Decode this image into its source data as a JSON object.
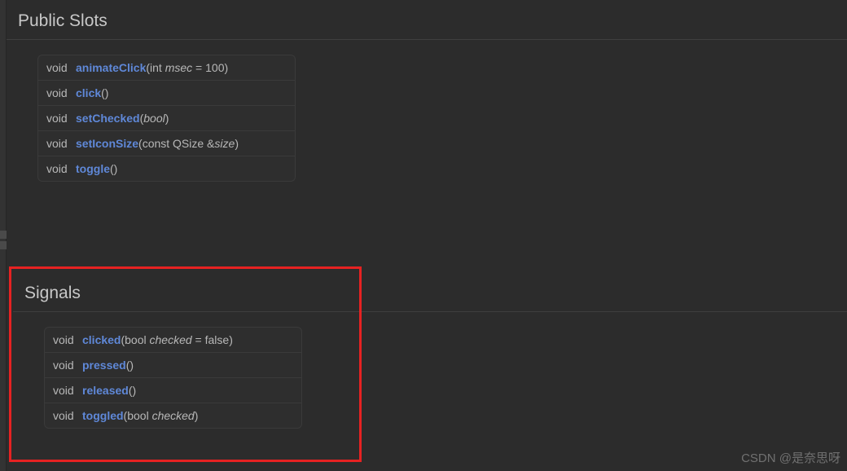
{
  "sections": {
    "slots": {
      "title": "Public Slots",
      "rowsRet": [
        "void",
        "void",
        "void",
        "void",
        "void"
      ],
      "rows": [
        {
          "fn": "animateClick",
          "params_pre": "(int ",
          "params_ital": "msec",
          "params_post": " = 100)"
        },
        {
          "fn": "click",
          "params_pre": "()",
          "params_ital": "",
          "params_post": ""
        },
        {
          "fn": "setChecked",
          "params_pre": "(",
          "params_ital": "bool",
          "params_post": ")"
        },
        {
          "fn": "setIconSize",
          "params_pre": "(const QSize &",
          "params_ital": "size",
          "params_post": ")"
        },
        {
          "fn": "toggle",
          "params_pre": "()",
          "params_ital": "",
          "params_post": ""
        }
      ]
    },
    "signals": {
      "title": "Signals",
      "rowsRet": [
        "void",
        "void",
        "void",
        "void"
      ],
      "rows": [
        {
          "fn": "clicked",
          "params_pre": "(bool ",
          "params_ital": "checked",
          "params_post": " = false)"
        },
        {
          "fn": "pressed",
          "params_pre": "()",
          "params_ital": "",
          "params_post": ""
        },
        {
          "fn": "released",
          "params_pre": "()",
          "params_ital": "",
          "params_post": ""
        },
        {
          "fn": "toggled",
          "params_pre": "(bool ",
          "params_ital": "checked",
          "params_post": ")"
        }
      ]
    }
  },
  "watermark": "CSDN @是奈思呀"
}
